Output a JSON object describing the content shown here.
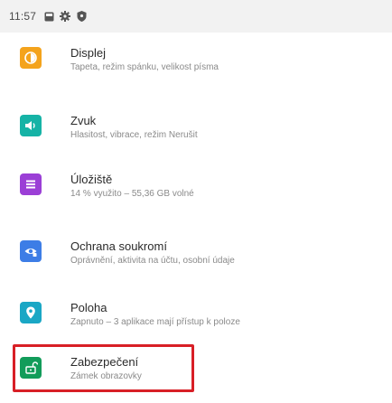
{
  "status_bar": {
    "time": "11:57",
    "icons": [
      "image-icon",
      "gear-icon",
      "shield-icon"
    ]
  },
  "settings": {
    "items": [
      {
        "title": "Displej",
        "subtitle": "Tapeta, režim spánku, velikost písma",
        "icon": "brightness-icon",
        "color": "#f4a31c"
      },
      {
        "title": "Zvuk",
        "subtitle": "Hlasitost, vibrace, režim Nerušit",
        "icon": "volume-icon",
        "color": "#16b3a6"
      },
      {
        "title": "Úložiště",
        "subtitle": "14 % využito – 55,36 GB volné",
        "icon": "storage-icon",
        "color": "#9b3fd6"
      },
      {
        "title": "Ochrana soukromí",
        "subtitle": "Oprávnění, aktivita na účtu, osobní údaje",
        "icon": "privacy-eye-icon",
        "color": "#3d7de6"
      },
      {
        "title": "Poloha",
        "subtitle": "Zapnuto – 3 aplikace mají přístup k poloze",
        "icon": "location-pin-icon",
        "color": "#1aa7c5"
      },
      {
        "title": "Zabezpečení",
        "subtitle": "Zámek obrazovky",
        "icon": "unlock-icon",
        "color": "#129c5a"
      }
    ],
    "highlighted_item": "Zabezpečení",
    "highlight_color": "#d81f26"
  }
}
